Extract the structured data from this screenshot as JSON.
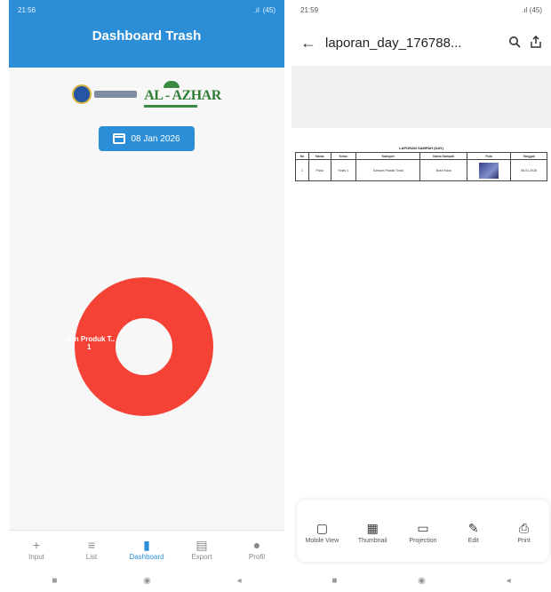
{
  "left": {
    "status": {
      "time": "21:56",
      "signal": ".ıl",
      "battery": "(45)"
    },
    "title": "Dashboard Trash",
    "logos": {
      "school_name": "AL - AZHAR"
    },
    "date_button": "08 Jan 2026",
    "chart_data": {
      "type": "pie",
      "donut": true,
      "categories": [
        "..dan Produk T.."
      ],
      "values": [
        1
      ],
      "colors": [
        "#f44336"
      ],
      "labels": [
        "..dan Produk T..",
        "1"
      ]
    },
    "nav": [
      {
        "label": "Input",
        "icon": "+"
      },
      {
        "label": "List",
        "icon": "≡"
      },
      {
        "label": "Dashboard",
        "icon": "▮"
      },
      {
        "label": "Export",
        "icon": "▤"
      },
      {
        "label": "Profil",
        "icon": "●"
      }
    ],
    "sysnav": {
      "home": "◉",
      "back": "◂",
      "recents": "■"
    }
  },
  "right": {
    "status": {
      "time": "21:59",
      "signal": ".ıl",
      "battery": "(45)"
    },
    "title": "laporan_day_176788...",
    "back_icon": "←",
    "doc": {
      "title": "LAPORAN SAMPAH (DAY)",
      "headers": [
        "No",
        "Nama",
        "Kelas",
        "Kategori",
        "Nama Sampah",
        "Foto",
        "Tanggal"
      ],
      "row": [
        "1",
        "Fiska",
        "Kelas 1",
        "Sampah Plastik Tunai",
        "Botol Kaca",
        "",
        "08-01-2026"
      ]
    },
    "toolbar": [
      {
        "label": "Mobile View",
        "icon": "▢"
      },
      {
        "label": "Thumbnail",
        "icon": "▦"
      },
      {
        "label": "Projection",
        "icon": "▭"
      },
      {
        "label": "Edit",
        "icon": "✎"
      },
      {
        "label": "Print",
        "icon": "⎙"
      }
    ],
    "sysnav": {
      "home": "◉",
      "back": "◂",
      "recents": "■"
    }
  },
  "colors": {
    "accent": "#2c8ed6",
    "donut": "#f44336"
  }
}
